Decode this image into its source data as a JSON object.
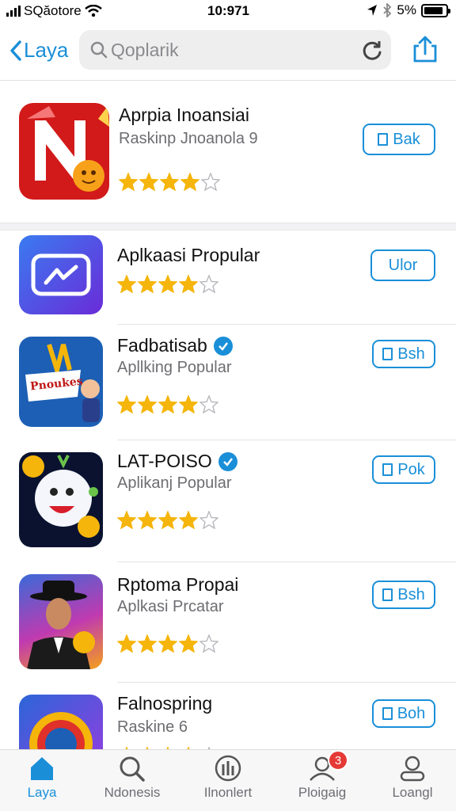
{
  "status_bar": {
    "carrier": "SQăotore",
    "time": "10:971",
    "battery": "5%",
    "battery_level": 0.9
  },
  "nav": {
    "back_label": "Laya",
    "search_placeholder": "Qoplarik"
  },
  "featured": {
    "title": "Aprpia Inoansiai",
    "subtitle": "Raskinp Jnoanola 9",
    "rating": 4,
    "button": "Bak"
  },
  "apps": [
    {
      "title": "Aplkaasi Propular",
      "subtitle": "",
      "rating": 4,
      "button": "Ulor",
      "verified": false
    },
    {
      "title": "Fadbatisab",
      "subtitle": "Apllking Popular",
      "rating": 4,
      "button": "Bsh",
      "verified": true,
      "icon_text": "Pnoukes"
    },
    {
      "title": "LAT-POISO",
      "subtitle": "Aplikanj Popular",
      "rating": 4,
      "button": "Pok",
      "verified": true
    },
    {
      "title": "Rptoma Propai",
      "subtitle": "Aplkasi Prcatar",
      "rating": 4,
      "button": "Bsh",
      "verified": false
    },
    {
      "title": "Falnospring",
      "subtitle": "Raskine 6",
      "rating": 4,
      "button": "Boh",
      "verified": false
    }
  ],
  "tabs": [
    {
      "label": "Laya",
      "icon": "home-icon",
      "active": true
    },
    {
      "label": "Ndonesis",
      "icon": "search-icon",
      "active": false
    },
    {
      "label": "Ilnonlert",
      "icon": "apps-icon",
      "active": false
    },
    {
      "label": "Ploigaig",
      "icon": "user-group-icon",
      "active": false,
      "badge": "3"
    },
    {
      "label": "Loangl",
      "icon": "profile-icon",
      "active": false
    }
  ],
  "colors": {
    "accent": "#1a8fd8",
    "star": "#f5b50a",
    "badge": "#e53935"
  }
}
